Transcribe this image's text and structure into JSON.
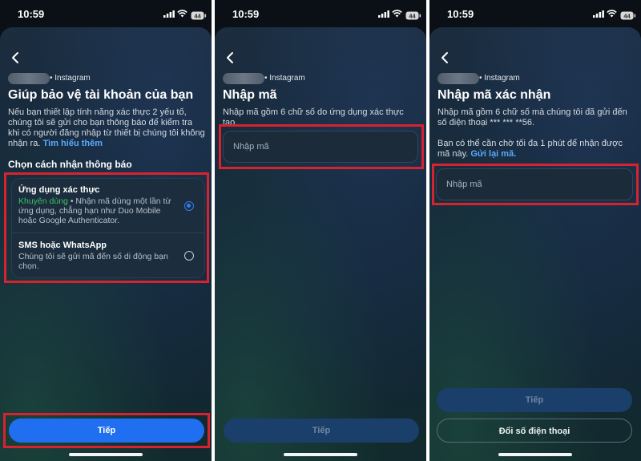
{
  "status_bar": {
    "time": "10:59",
    "battery": "44"
  },
  "account_label": "• Instagram",
  "screen1": {
    "title": "Giúp bảo vệ tài khoản của bạn",
    "description": "Nếu bạn thiết lập tính năng xác thực 2 yếu tố, chúng tôi sẽ gửi cho bạn thông báo để kiểm tra khi có người đăng nhập từ thiết bị chúng tôi không nhận ra.",
    "learn_more": "Tìm hiểu thêm",
    "section_label": "Chọn cách nhận thông báo",
    "options": [
      {
        "title": "Ứng dụng xác thực",
        "badge": "Khuyên dùng",
        "description": "• Nhận mã dùng một lần từ ứng dụng, chẳng hạn như Duo Mobile hoặc Google Authenticator.",
        "selected": true
      },
      {
        "title": "SMS hoặc WhatsApp",
        "description": "Chúng tôi sẽ gửi mã đến số di động bạn chọn.",
        "selected": false
      }
    ],
    "next_button": "Tiếp"
  },
  "screen2": {
    "title": "Nhập mã",
    "description": "Nhập mã gồm 6 chữ số do ứng dụng xác thực tạo.",
    "input_placeholder": "Nhập mã",
    "next_button": "Tiếp"
  },
  "screen3": {
    "title": "Nhập mã xác nhận",
    "description": "Nhập mã gồm 6 chữ số mà chúng tôi đã gửi đến số điện thoại *** *** **56.",
    "wait_text": "Bạn có thể cần chờ tối đa 1 phút để nhận được mã này.",
    "resend_link": "Gửi lại mã.",
    "input_placeholder": "Nhập mã",
    "next_button": "Tiếp",
    "change_number_button": "Đổi số điện thoại"
  },
  "colors": {
    "accent": "#1f6ff0",
    "link": "#5aa8ff",
    "recommended": "#39c36b",
    "highlight": "#d6232f"
  },
  "icons": [
    "back-arrow-icon",
    "signal-icon",
    "wifi-icon",
    "battery-icon"
  ]
}
